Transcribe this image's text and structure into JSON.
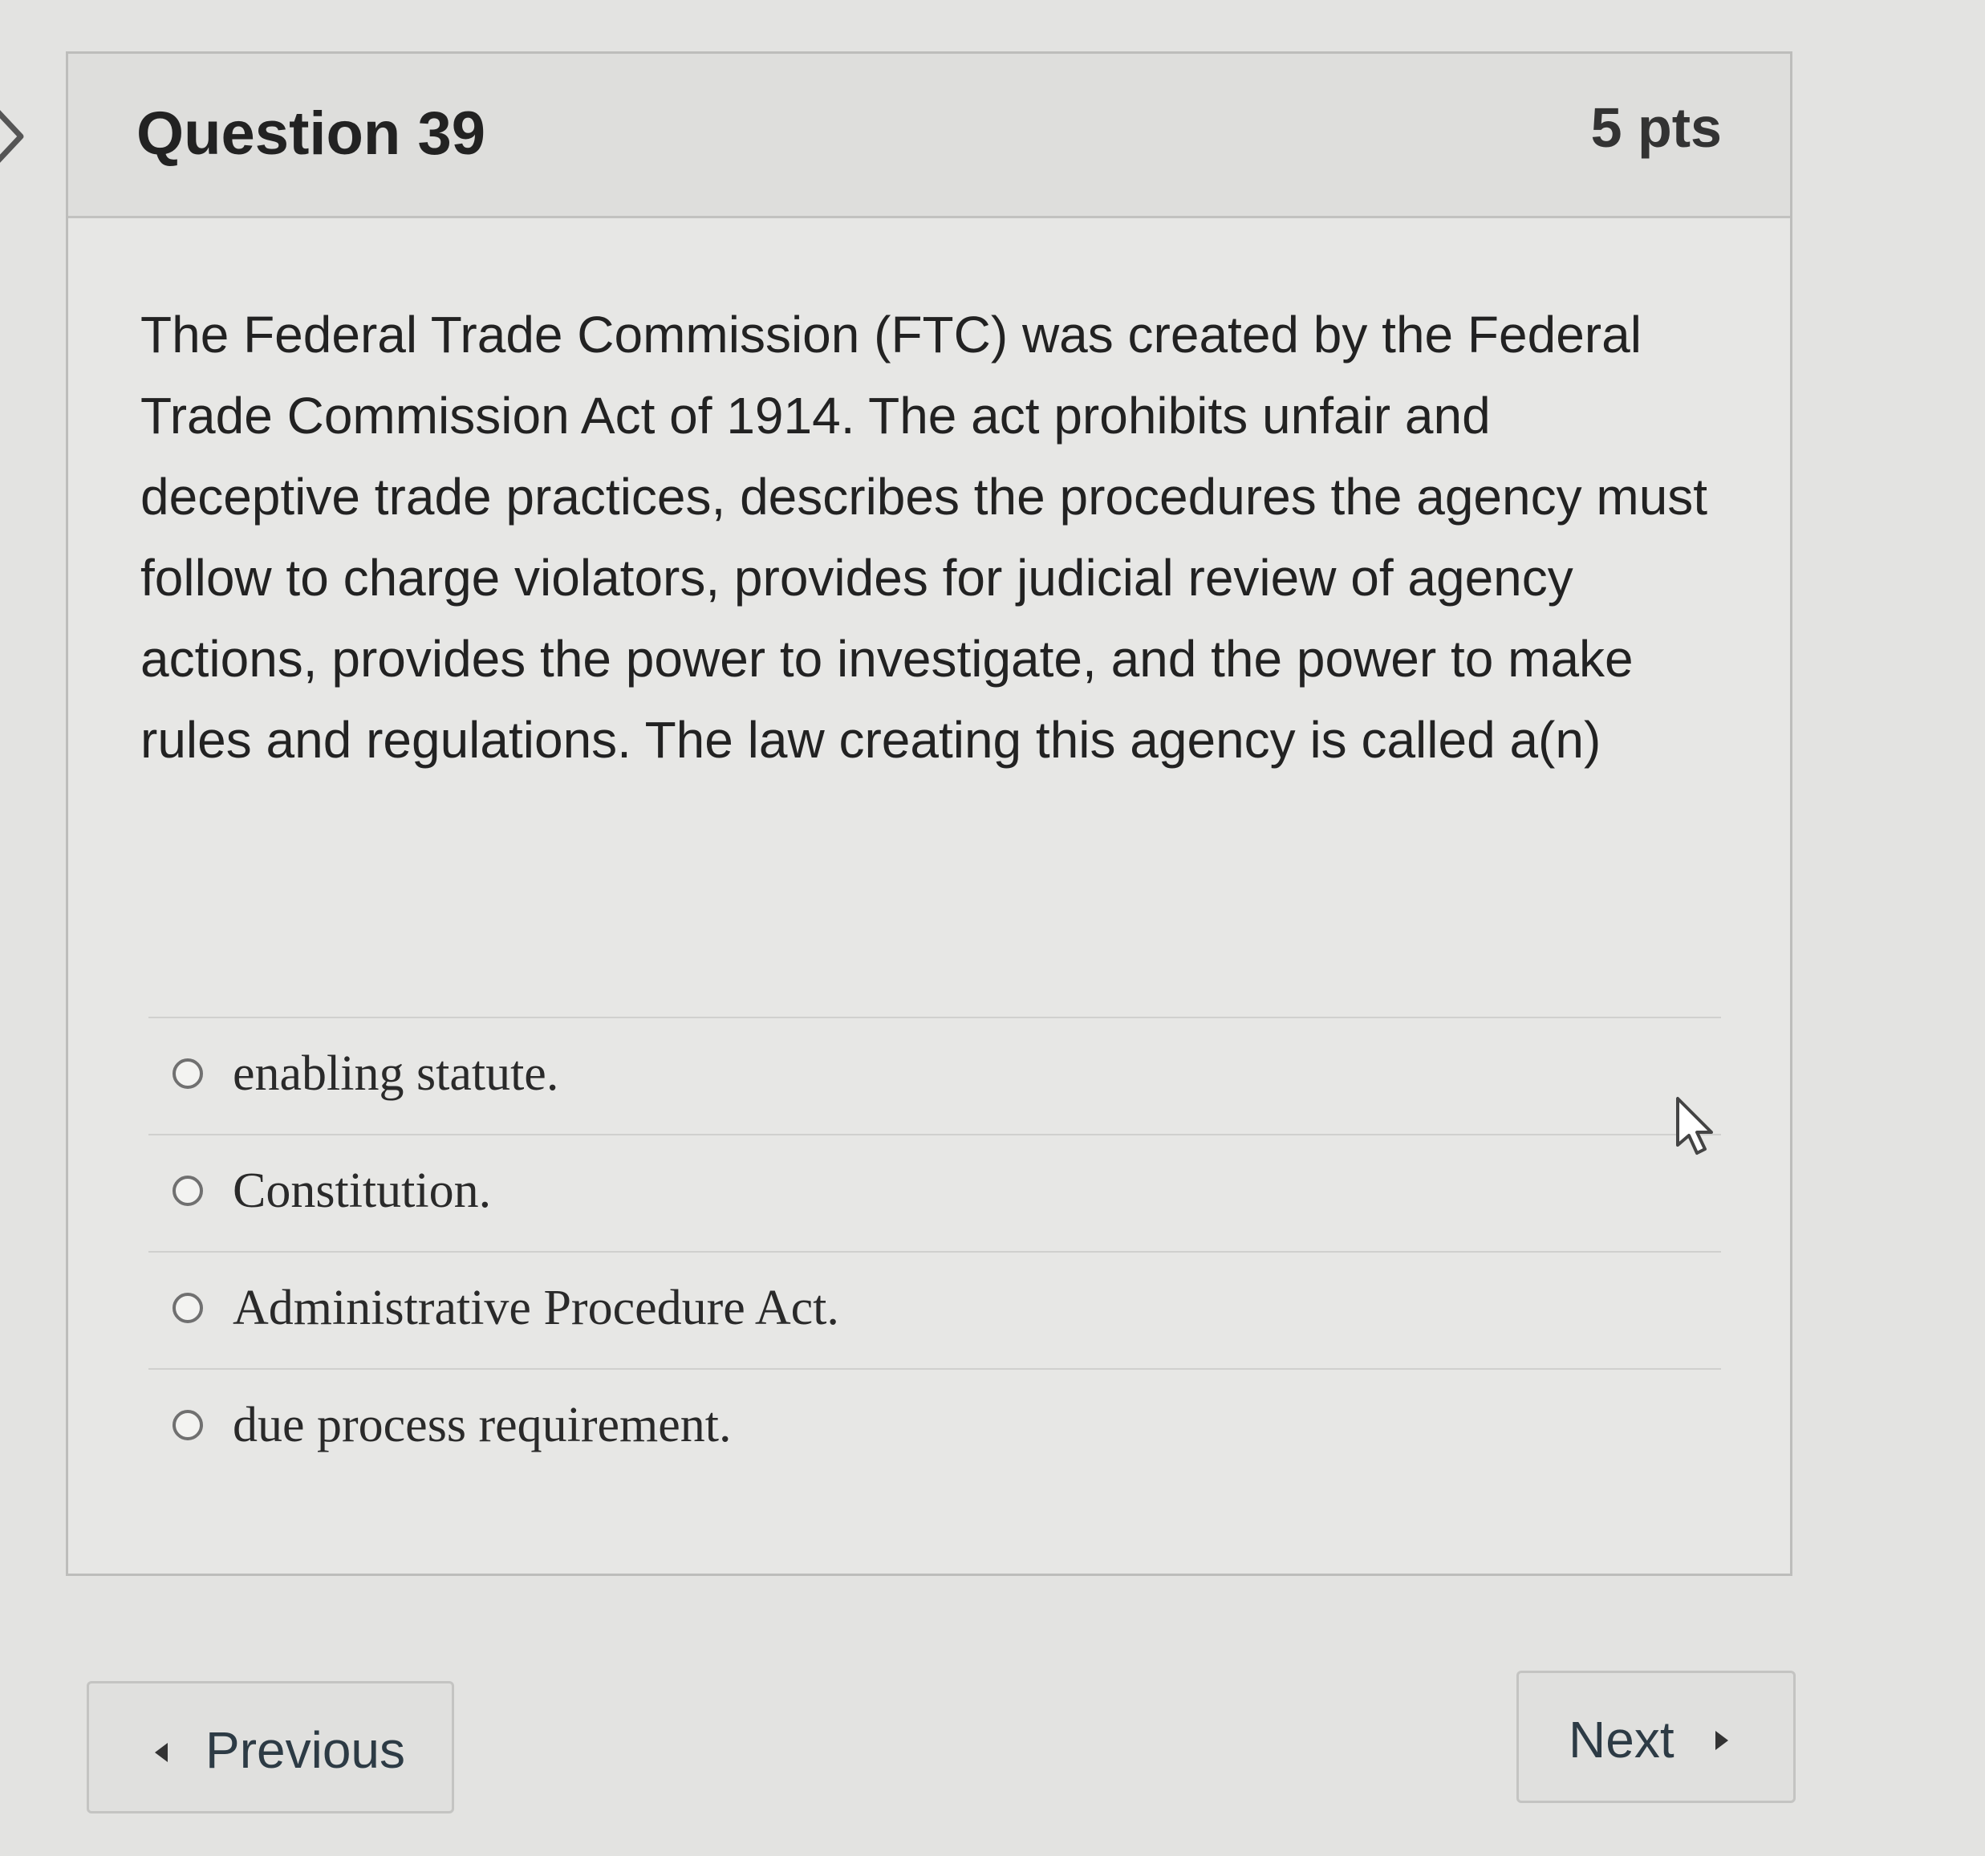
{
  "question": {
    "title": "Question 39",
    "points": "5 pts",
    "text": "The Federal Trade Commission (FTC) was created by the Federal Trade Commission Act of 1914. The act prohibits unfair and deceptive trade practices, describes the procedures the agency must follow to charge violators, provides for judicial review of agency actions, provides the power to investigate, and the power to make rules and regulations. The law creating this agency is called a(n)"
  },
  "answers": [
    {
      "label": "enabling statute."
    },
    {
      "label": "Constitution."
    },
    {
      "label": "Administrative Procedure Act."
    },
    {
      "label": "due process requirement."
    }
  ],
  "navigation": {
    "previous_label": "Previous",
    "next_label": "Next"
  },
  "icons": {
    "collapse": "chevron-right-icon",
    "cursor": "mouse-pointer-icon",
    "previous_caret": "caret-left-icon",
    "next_caret": "caret-right-icon"
  }
}
